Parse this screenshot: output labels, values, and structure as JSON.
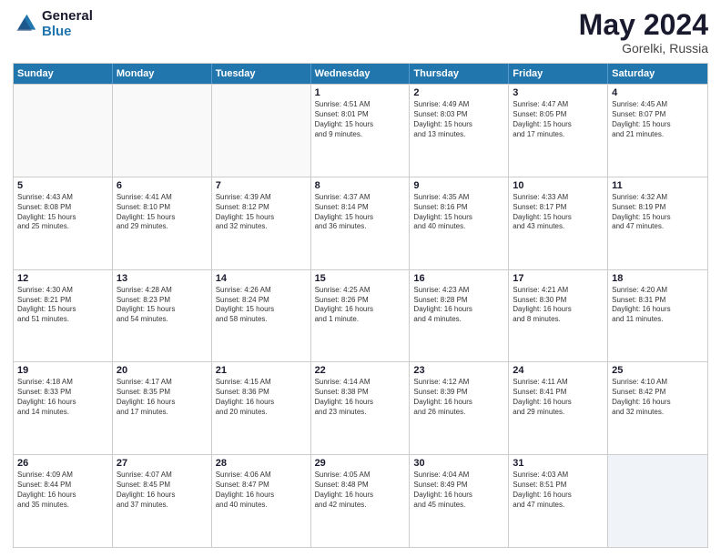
{
  "header": {
    "logo_line1": "General",
    "logo_line2": "Blue",
    "month": "May 2024",
    "location": "Gorelki, Russia"
  },
  "days_of_week": [
    "Sunday",
    "Monday",
    "Tuesday",
    "Wednesday",
    "Thursday",
    "Friday",
    "Saturday"
  ],
  "weeks": [
    [
      {
        "day": "",
        "info": ""
      },
      {
        "day": "",
        "info": ""
      },
      {
        "day": "",
        "info": ""
      },
      {
        "day": "1",
        "info": "Sunrise: 4:51 AM\nSunset: 8:01 PM\nDaylight: 15 hours\nand 9 minutes."
      },
      {
        "day": "2",
        "info": "Sunrise: 4:49 AM\nSunset: 8:03 PM\nDaylight: 15 hours\nand 13 minutes."
      },
      {
        "day": "3",
        "info": "Sunrise: 4:47 AM\nSunset: 8:05 PM\nDaylight: 15 hours\nand 17 minutes."
      },
      {
        "day": "4",
        "info": "Sunrise: 4:45 AM\nSunset: 8:07 PM\nDaylight: 15 hours\nand 21 minutes."
      }
    ],
    [
      {
        "day": "5",
        "info": "Sunrise: 4:43 AM\nSunset: 8:08 PM\nDaylight: 15 hours\nand 25 minutes."
      },
      {
        "day": "6",
        "info": "Sunrise: 4:41 AM\nSunset: 8:10 PM\nDaylight: 15 hours\nand 29 minutes."
      },
      {
        "day": "7",
        "info": "Sunrise: 4:39 AM\nSunset: 8:12 PM\nDaylight: 15 hours\nand 32 minutes."
      },
      {
        "day": "8",
        "info": "Sunrise: 4:37 AM\nSunset: 8:14 PM\nDaylight: 15 hours\nand 36 minutes."
      },
      {
        "day": "9",
        "info": "Sunrise: 4:35 AM\nSunset: 8:16 PM\nDaylight: 15 hours\nand 40 minutes."
      },
      {
        "day": "10",
        "info": "Sunrise: 4:33 AM\nSunset: 8:17 PM\nDaylight: 15 hours\nand 43 minutes."
      },
      {
        "day": "11",
        "info": "Sunrise: 4:32 AM\nSunset: 8:19 PM\nDaylight: 15 hours\nand 47 minutes."
      }
    ],
    [
      {
        "day": "12",
        "info": "Sunrise: 4:30 AM\nSunset: 8:21 PM\nDaylight: 15 hours\nand 51 minutes."
      },
      {
        "day": "13",
        "info": "Sunrise: 4:28 AM\nSunset: 8:23 PM\nDaylight: 15 hours\nand 54 minutes."
      },
      {
        "day": "14",
        "info": "Sunrise: 4:26 AM\nSunset: 8:24 PM\nDaylight: 15 hours\nand 58 minutes."
      },
      {
        "day": "15",
        "info": "Sunrise: 4:25 AM\nSunset: 8:26 PM\nDaylight: 16 hours\nand 1 minute."
      },
      {
        "day": "16",
        "info": "Sunrise: 4:23 AM\nSunset: 8:28 PM\nDaylight: 16 hours\nand 4 minutes."
      },
      {
        "day": "17",
        "info": "Sunrise: 4:21 AM\nSunset: 8:30 PM\nDaylight: 16 hours\nand 8 minutes."
      },
      {
        "day": "18",
        "info": "Sunrise: 4:20 AM\nSunset: 8:31 PM\nDaylight: 16 hours\nand 11 minutes."
      }
    ],
    [
      {
        "day": "19",
        "info": "Sunrise: 4:18 AM\nSunset: 8:33 PM\nDaylight: 16 hours\nand 14 minutes."
      },
      {
        "day": "20",
        "info": "Sunrise: 4:17 AM\nSunset: 8:35 PM\nDaylight: 16 hours\nand 17 minutes."
      },
      {
        "day": "21",
        "info": "Sunrise: 4:15 AM\nSunset: 8:36 PM\nDaylight: 16 hours\nand 20 minutes."
      },
      {
        "day": "22",
        "info": "Sunrise: 4:14 AM\nSunset: 8:38 PM\nDaylight: 16 hours\nand 23 minutes."
      },
      {
        "day": "23",
        "info": "Sunrise: 4:12 AM\nSunset: 8:39 PM\nDaylight: 16 hours\nand 26 minutes."
      },
      {
        "day": "24",
        "info": "Sunrise: 4:11 AM\nSunset: 8:41 PM\nDaylight: 16 hours\nand 29 minutes."
      },
      {
        "day": "25",
        "info": "Sunrise: 4:10 AM\nSunset: 8:42 PM\nDaylight: 16 hours\nand 32 minutes."
      }
    ],
    [
      {
        "day": "26",
        "info": "Sunrise: 4:09 AM\nSunset: 8:44 PM\nDaylight: 16 hours\nand 35 minutes."
      },
      {
        "day": "27",
        "info": "Sunrise: 4:07 AM\nSunset: 8:45 PM\nDaylight: 16 hours\nand 37 minutes."
      },
      {
        "day": "28",
        "info": "Sunrise: 4:06 AM\nSunset: 8:47 PM\nDaylight: 16 hours\nand 40 minutes."
      },
      {
        "day": "29",
        "info": "Sunrise: 4:05 AM\nSunset: 8:48 PM\nDaylight: 16 hours\nand 42 minutes."
      },
      {
        "day": "30",
        "info": "Sunrise: 4:04 AM\nSunset: 8:49 PM\nDaylight: 16 hours\nand 45 minutes."
      },
      {
        "day": "31",
        "info": "Sunrise: 4:03 AM\nSunset: 8:51 PM\nDaylight: 16 hours\nand 47 minutes."
      },
      {
        "day": "",
        "info": ""
      }
    ]
  ]
}
